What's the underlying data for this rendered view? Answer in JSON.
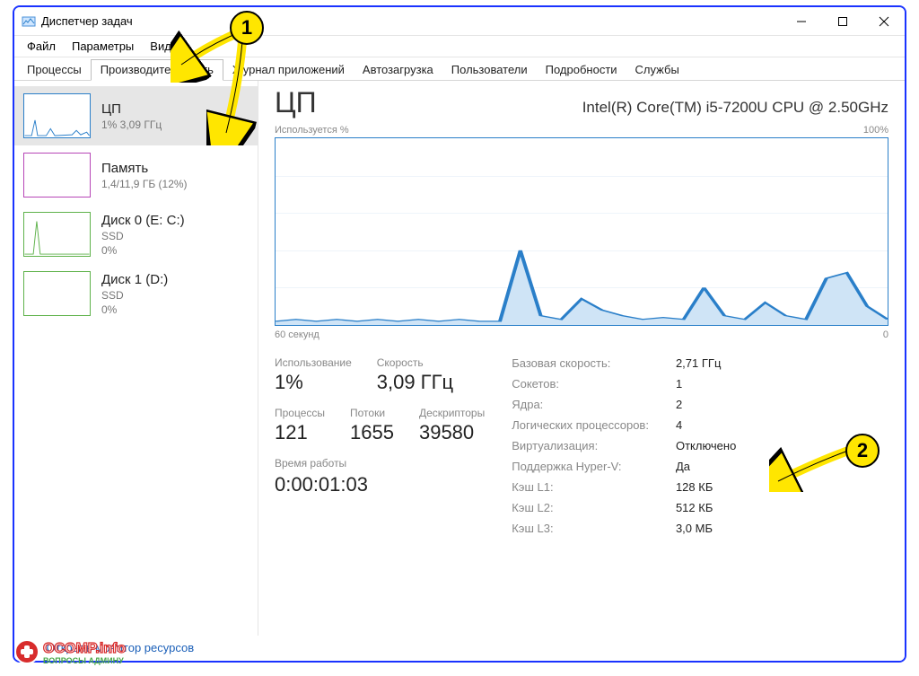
{
  "window_title": "Диспетчер задач",
  "menu": [
    "Файл",
    "Параметры",
    "Вид"
  ],
  "tabs": [
    "Процессы",
    "Производительность",
    "Журнал приложений",
    "Автозагрузка",
    "Пользователи",
    "Подробности",
    "Службы"
  ],
  "active_tab_index": 1,
  "sidebar": [
    {
      "title": "ЦП",
      "sub": "1%  3,09 ГГц",
      "color": "#2a7fc9",
      "type": "cpu"
    },
    {
      "title": "Память",
      "sub": "1,4/11,9 ГБ (12%)",
      "color": "#b746b7",
      "type": "memory"
    },
    {
      "title": "Диск 0 (E: C:)",
      "sub": "SSD",
      "sub2": "0%",
      "color": "#5fb24b",
      "type": "disk"
    },
    {
      "title": "Диск 1 (D:)",
      "sub": "SSD",
      "sub2": "0%",
      "color": "#5fb24b",
      "type": "disk-empty"
    }
  ],
  "content": {
    "title": "ЦП",
    "model": "Intel(R) Core(TM) i5-7200U CPU @ 2.50GHz",
    "chart_top_left": "Используется %",
    "chart_top_right": "100%",
    "chart_bottom_left": "60 секунд",
    "chart_bottom_right": "0",
    "stats_left": {
      "row1": [
        {
          "label": "Использование",
          "value": "1%"
        },
        {
          "label": "Скорость",
          "value": "3,09 ГГц"
        }
      ],
      "row2": [
        {
          "label": "Процессы",
          "value": "121"
        },
        {
          "label": "Потоки",
          "value": "1655"
        },
        {
          "label": "Дескрипторы",
          "value": "39580"
        }
      ],
      "uptime_label": "Время работы",
      "uptime_value": "0:00:01:03"
    },
    "stats_right": {
      "labels": [
        "Базовая скорость:",
        "Сокетов:",
        "Ядра:",
        "Логических процессоров:",
        "Виртуализация:",
        "Поддержка Hyper-V:",
        "Кэш L1:",
        "Кэш L2:",
        "Кэш L3:"
      ],
      "values": [
        "2,71 ГГц",
        "1",
        "2",
        "4",
        "Отключено",
        "Да",
        "128 КБ",
        "512 КБ",
        "3,0 МБ"
      ]
    }
  },
  "footer_link": "Открыть монитор ресурсов",
  "annotations": {
    "1": "1",
    "2": "2"
  },
  "watermark_top": "OCOMP.info",
  "watermark_bottom": "ВОПРОСЫ АДМИНУ",
  "chart_data": {
    "type": "area",
    "title": "Используется %",
    "xlabel": "60 секунд",
    "ylabel": "%",
    "ylim": [
      0,
      100
    ],
    "x": [
      0,
      2,
      4,
      6,
      8,
      10,
      12,
      14,
      16,
      18,
      20,
      22,
      24,
      26,
      28,
      30,
      32,
      34,
      36,
      38,
      40,
      42,
      44,
      46,
      48,
      50,
      52,
      54,
      56,
      58,
      60
    ],
    "values": [
      2,
      3,
      2,
      3,
      2,
      3,
      2,
      3,
      2,
      3,
      2,
      2,
      40,
      5,
      3,
      14,
      8,
      5,
      3,
      4,
      3,
      20,
      5,
      3,
      12,
      5,
      3,
      25,
      28,
      10,
      3
    ]
  }
}
